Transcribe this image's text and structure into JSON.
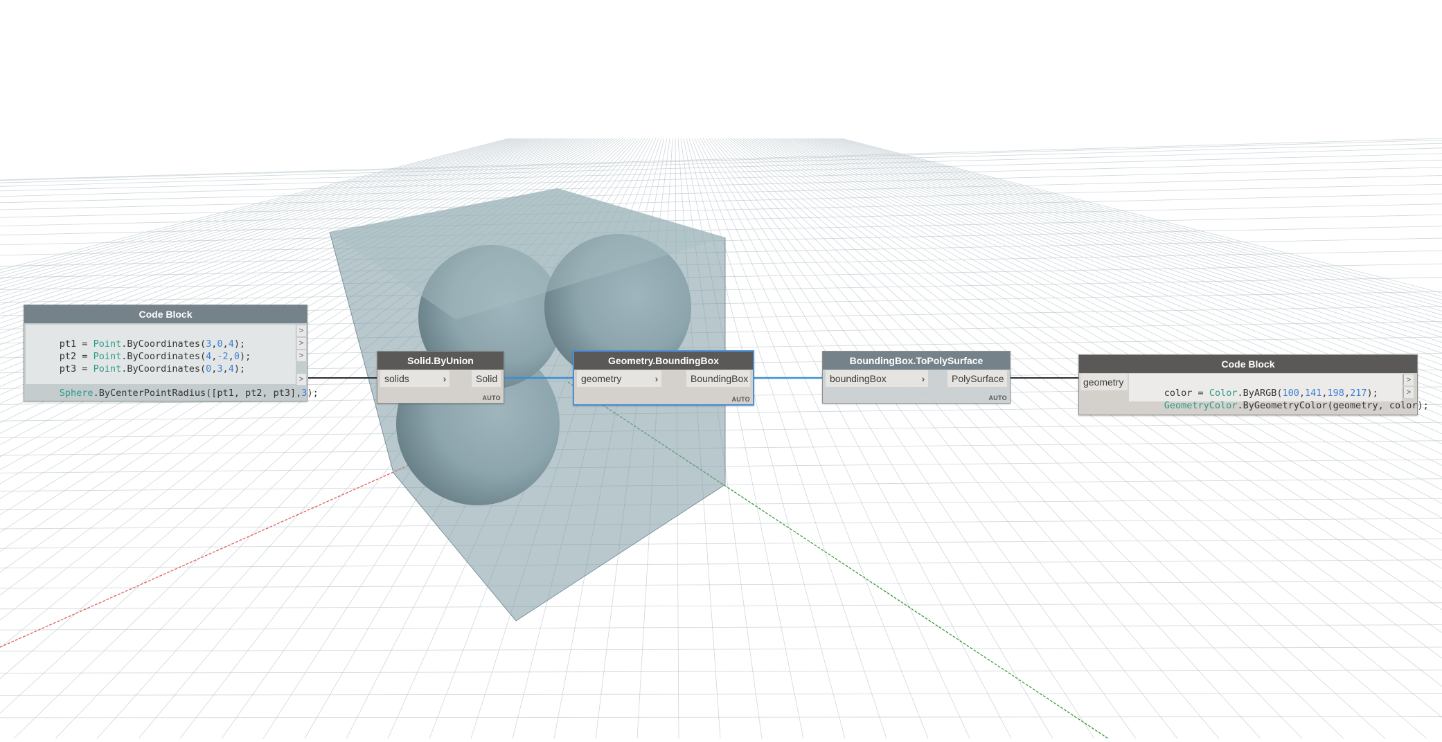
{
  "nodes": {
    "code_block_1": {
      "title": "Code Block",
      "lines": [
        {
          "pre": "pt1 = ",
          "cls": "Point",
          "mid": ".ByCoordinates(",
          "nums": [
            "3",
            "0",
            "4"
          ],
          "post": ");"
        },
        {
          "pre": "pt2 = ",
          "cls": "Point",
          "mid": ".ByCoordinates(",
          "nums": [
            "4",
            "-2",
            "0"
          ],
          "post": ");"
        },
        {
          "pre": "pt3 = ",
          "cls": "Point",
          "mid": ".ByCoordinates(",
          "nums": [
            "0",
            "3",
            "4"
          ],
          "post": ");"
        }
      ],
      "line4": {
        "cls": "Sphere",
        "mid": ".ByCenterPointRadius([pt1, pt2, pt3],",
        "num": "3",
        "post": ");"
      },
      "out_arrow": ">"
    },
    "solid_by_union": {
      "title": "Solid.ByUnion",
      "input": "solids",
      "output": "Solid",
      "lacing": "AUTO"
    },
    "geometry_bounding_box": {
      "title": "Geometry.BoundingBox",
      "input": "geometry",
      "output": "BoundingBox",
      "lacing": "AUTO"
    },
    "bbox_to_polysurface": {
      "title": "BoundingBox.ToPolySurface",
      "input": "boundingBox",
      "output": "PolySurface",
      "lacing": "AUTO"
    },
    "code_block_2": {
      "title": "Code Block",
      "input": "geometry",
      "line1": {
        "pre": "color = ",
        "cls": "Color",
        "mid": ".ByARGB(",
        "nums": [
          "100",
          "141",
          "198",
          "217"
        ],
        "post": ");"
      },
      "line2": {
        "cls": "GeometryColor",
        "mid": ".ByGeometryColor(geometry, color);"
      },
      "out_arrow": ">"
    }
  },
  "icons": {
    "port_chevron": "chevron-right-icon",
    "output_arrow": "output-arrow-icon"
  },
  "colors": {
    "node_header": "#5a5957",
    "node_header_grey": "#76828a",
    "selection": "#4a90d9",
    "x_axis": "#d9534f",
    "y_axis": "#3a9a3a",
    "bounding_box": "#8ea9b0",
    "sphere": "#b7c4c9"
  }
}
